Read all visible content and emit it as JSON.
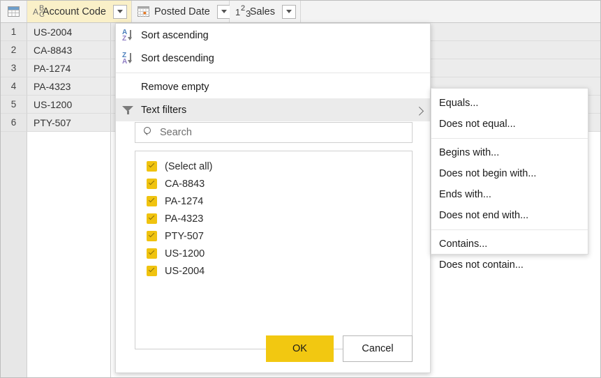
{
  "grid": {
    "table_icon": "table-icon",
    "columns": [
      {
        "icon": "abc-icon",
        "label": "Account Code",
        "dropdown_icon": "chevron-down-icon",
        "active": true
      },
      {
        "icon": "calendar-icon",
        "label": "Posted Date",
        "dropdown_icon": "chevron-down-icon",
        "active": false
      },
      {
        "icon": "123-icon",
        "label": "Sales",
        "dropdown_icon": "chevron-down-icon",
        "active": false
      }
    ],
    "rows": [
      {
        "num": "1",
        "account_code": "US-2004"
      },
      {
        "num": "2",
        "account_code": "CA-8843"
      },
      {
        "num": "3",
        "account_code": "PA-1274"
      },
      {
        "num": "4",
        "account_code": "PA-4323"
      },
      {
        "num": "5",
        "account_code": "US-1200"
      },
      {
        "num": "6",
        "account_code": "PTY-507"
      }
    ]
  },
  "filter_menu": {
    "sort_ascending": "Sort ascending",
    "sort_ascending_icon": "sort-a-to-z-icon",
    "sort_descending": "Sort descending",
    "sort_descending_icon": "sort-z-to-a-icon",
    "remove_empty": "Remove empty",
    "text_filters": "Text filters",
    "text_filters_icon": "filter-funnel-icon",
    "text_filters_chevron": "chevron-right-icon",
    "search": {
      "icon": "search-icon",
      "placeholder": "Search",
      "value": ""
    },
    "checklist": [
      {
        "label": "(Select all)",
        "checked": true
      },
      {
        "label": "CA-8843",
        "checked": true
      },
      {
        "label": "PA-1274",
        "checked": true
      },
      {
        "label": "PA-4323",
        "checked": true
      },
      {
        "label": "PTY-507",
        "checked": true
      },
      {
        "label": "US-1200",
        "checked": true
      },
      {
        "label": "US-2004",
        "checked": true
      }
    ],
    "ok_label": "OK",
    "cancel_label": "Cancel"
  },
  "text_filters_submenu": {
    "group1": [
      "Equals...",
      "Does not equal..."
    ],
    "group2": [
      "Begins with...",
      "Does not begin with...",
      "Ends with...",
      "Does not end with..."
    ],
    "group3": [
      "Contains...",
      "Does not contain..."
    ]
  },
  "colors": {
    "accent_yellow": "#f2c811",
    "header_highlight": "#faf0c8",
    "grid_header_bg": "#f3f3f3",
    "row_bg": "#ececec",
    "gutter_bg": "#e7e7e7"
  }
}
